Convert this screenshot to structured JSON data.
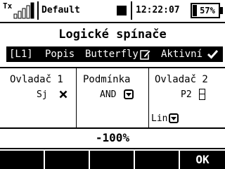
{
  "status": {
    "tx_label": "Tx",
    "model_name": "Default",
    "clock": "12:22:07",
    "battery_text": "57%",
    "battery_level": 0.57
  },
  "title": "Logické spínače",
  "switch_row": {
    "id": "[L1]",
    "desc_label": "Popis",
    "name": "Butterfly",
    "state": "Aktivní",
    "state_icon": "check-icon",
    "edit_icon": "pencil-icon"
  },
  "columns": [
    {
      "label": "Ovladač 1",
      "value": "Sj",
      "icon": "x-icon"
    },
    {
      "label": "Podmínka",
      "value": "AND",
      "icon": "dropdown-icon"
    },
    {
      "label": "Ovladač 2",
      "value": "P2",
      "icon": "split-icon",
      "sub_value": "Lin",
      "sub_icon": "dropdown-icon"
    }
  ],
  "value": "-100%",
  "softkeys": [
    "",
    "",
    "",
    "",
    "OK"
  ]
}
